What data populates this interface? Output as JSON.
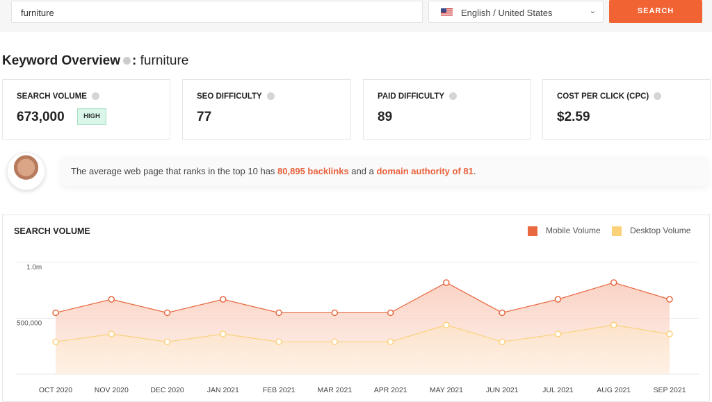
{
  "search": {
    "value": "furniture",
    "language": "English / United States",
    "button": "SEARCH"
  },
  "overview": {
    "title": "Keyword Overview",
    "separator": ":",
    "keyword": "furniture"
  },
  "cards": [
    {
      "label": "SEARCH VOLUME",
      "value": "673,000",
      "badge": "HIGH"
    },
    {
      "label": "SEO DIFFICULTY",
      "value": "77"
    },
    {
      "label": "PAID DIFFICULTY",
      "value": "89"
    },
    {
      "label": "COST PER CLICK (CPC)",
      "value": "$2.59"
    }
  ],
  "banner": {
    "pre": "The average web page that ranks in the top 10 has ",
    "backlinks": "80,895 backlinks",
    "mid": " and a ",
    "authority": "domain authority of 81",
    "post": "."
  },
  "colors": {
    "accent": "#f26334",
    "mobile": "#e8683f",
    "desktop": "#fbd27a"
  },
  "chart_data": {
    "type": "area",
    "title": "SEARCH VOLUME",
    "categories": [
      "OCT 2020",
      "NOV 2020",
      "DEC 2020",
      "JAN 2021",
      "FEB 2021",
      "MAR 2021",
      "APR 2021",
      "MAY 2021",
      "JUN 2021",
      "JUL 2021",
      "AUG 2021",
      "SEP 2021"
    ],
    "series": [
      {
        "name": "Mobile Volume",
        "values": [
          550000,
          670000,
          550000,
          670000,
          550000,
          550000,
          550000,
          820000,
          550000,
          670000,
          820000,
          670000
        ]
      },
      {
        "name": "Desktop Volume",
        "values": [
          290000,
          360000,
          290000,
          360000,
          290000,
          290000,
          290000,
          440000,
          290000,
          360000,
          440000,
          360000
        ]
      }
    ],
    "yticks": [
      {
        "v": 1000000,
        "label": "1.0m"
      },
      {
        "v": 500000,
        "label": "500,000"
      }
    ],
    "ylim": [
      0,
      1000000
    ],
    "grid": true,
    "legend": "top-right"
  }
}
